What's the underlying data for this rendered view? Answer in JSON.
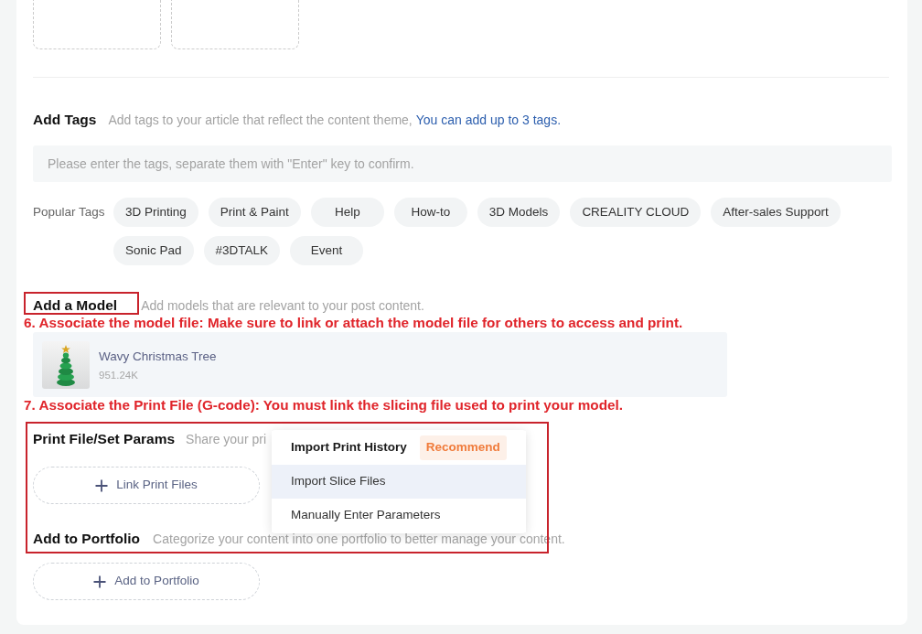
{
  "upload_slots": [
    {
      "kind": "dropzone"
    },
    {
      "kind": "dropzone"
    }
  ],
  "tags_section": {
    "title": "Add Tags",
    "description": "Add tags to your article that reflect the content theme,",
    "limit_note": "You can add up to 3 tags.",
    "input": {
      "placeholder": "Please enter the tags, separate them with \"Enter\" key to confirm."
    },
    "popular": {
      "label": "Popular Tags",
      "tags": [
        "3D Printing",
        "Print & Paint",
        "Help",
        "How-to",
        "3D Models",
        "CREALITY CLOUD",
        "After-sales Support",
        "Sonic Pad",
        "#3DTALK",
        "Event"
      ]
    }
  },
  "model_section": {
    "title": "Add a Model",
    "description": "Add models that are relevant to your post content.",
    "marked": true,
    "note": "6. Associate the model file: Make sure to link or attach the model file for others to access and print.",
    "models": [
      {
        "name": "Wavy Christmas Tree",
        "size": "951.24K"
      }
    ]
  },
  "marked_group": {
    "note": "7. Associate the Print File (G-code): You must link the slicing file used to print your model.",
    "marked": true,
    "print_files": {
      "title": "Print File/Set Params",
      "description": "Share your pri",
      "button": "Link Print Files",
      "menu": [
        {
          "kind": "featured",
          "label": "Import Print History",
          "badge": "Recommend",
          "highlighted": false
        },
        {
          "kind": "option",
          "label": "Import Slice Files",
          "highlighted": true
        },
        {
          "kind": "option",
          "label": "Manually Enter Parameters",
          "highlighted": false
        }
      ]
    },
    "portfolio": {
      "title": "Add to Portfolio",
      "description": "Categorize your content into one portfolio to better manage your content.",
      "button": "Add to Portfolio"
    }
  }
}
